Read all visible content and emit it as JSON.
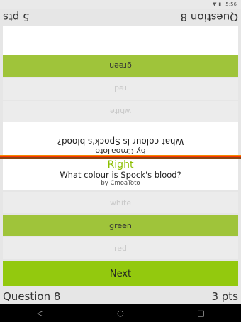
{
  "status": {
    "time": "5:56",
    "wifi_icon": "wifi-icon",
    "battery_icon": "battery-icon"
  },
  "top_player": {
    "question_label": "Question 8",
    "points": "5 pts",
    "question": "What colour is Spock's blood?",
    "author": "by CmoaToto",
    "answers": [
      "green",
      "red",
      "white"
    ]
  },
  "bottom_player": {
    "result": "Right",
    "question": "What colour is Spock's blood?",
    "author": "by CmoaToto",
    "answers": [
      "white",
      "green",
      "red"
    ],
    "next_label": "Next",
    "question_label": "Question 8",
    "points": "3 pts"
  },
  "colors": {
    "correct": "#9fc43a",
    "next": "#93c90e",
    "result": "#8bbf00"
  },
  "navbar": {
    "back_icon": "◁",
    "home_icon": "○",
    "recents_icon": "□"
  }
}
